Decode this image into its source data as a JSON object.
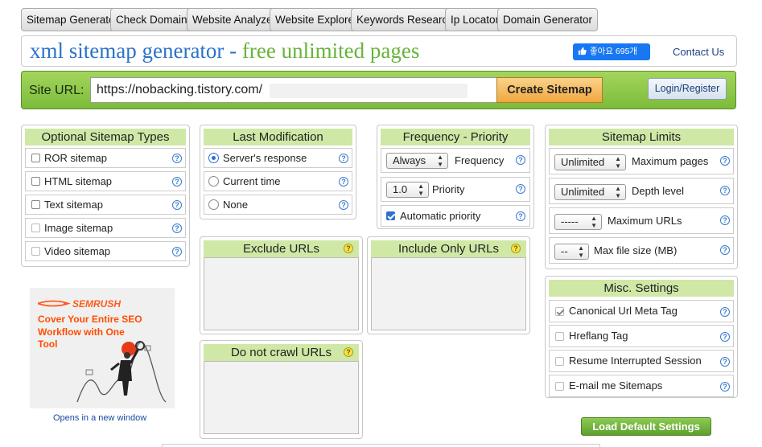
{
  "tabs": [
    "Sitemap Generator",
    "Check Domains",
    "Website Analyzer",
    "Website Explorer",
    "Keywords Research",
    "Ip Locator",
    "Domain Generator"
  ],
  "header": {
    "title_part1": "xml sitemap generator -",
    "title_part2": "free unlimited pages",
    "fb_like": "좋아요 695개",
    "contact": "Contact Us"
  },
  "urlbar": {
    "label": "Site URL:",
    "value": "https://nobacking.tistory.com/",
    "create_button": "Create Sitemap",
    "login_button": "Login/Register"
  },
  "optional_types": {
    "title": "Optional Sitemap Types",
    "items": [
      {
        "label": "ROR sitemap",
        "checked": false
      },
      {
        "label": "HTML sitemap",
        "checked": false
      },
      {
        "label": "Text sitemap",
        "checked": false
      },
      {
        "label": "Image sitemap",
        "checked": false
      },
      {
        "label": "Video sitemap",
        "checked": false
      }
    ]
  },
  "last_modification": {
    "title": "Last Modification",
    "options": [
      "Server's response",
      "Current time",
      "None"
    ],
    "selected": "Server's response"
  },
  "frequency_priority": {
    "title": "Frequency - Priority",
    "frequency_value": "Always",
    "frequency_label": "Frequency",
    "priority_value": "1.0",
    "priority_label": "Priority",
    "auto_priority_label": "Automatic priority",
    "auto_priority_checked": true
  },
  "sitemap_limits": {
    "title": "Sitemap Limits",
    "max_pages_value": "Unlimited",
    "max_pages_label": "Maximum pages",
    "depth_value": "Unlimited",
    "depth_label": "Depth level",
    "max_urls_value": "-----",
    "max_urls_label": "Maximum URLs",
    "max_size_value": "--",
    "max_size_label": "Max file size (MB)"
  },
  "exclude_urls": {
    "title": "Exclude URLs"
  },
  "include_only_urls": {
    "title": "Include Only URLs"
  },
  "do_not_crawl": {
    "title": "Do not crawl URLs"
  },
  "misc_settings": {
    "title": "Misc. Settings",
    "items": [
      {
        "label": "Canonical Url Meta Tag",
        "checked": true
      },
      {
        "label": "Hreflang Tag",
        "checked": false
      },
      {
        "label": "Resume Interrupted Session",
        "checked": false
      },
      {
        "label": "E-mail me Sitemaps",
        "checked": false
      }
    ]
  },
  "ad": {
    "brand": "SEMRUSH",
    "headline": "Cover Your Entire SEO Workflow with One Tool",
    "link": "Opens in a new window"
  },
  "load_default_button": "Load Default Settings",
  "help_glyph": "?",
  "colors": {
    "accent_blue": "#2b73c9",
    "accent_green": "#67b33a",
    "panel_header": "#cfe8a6",
    "bar_green": "#8cc84b"
  }
}
